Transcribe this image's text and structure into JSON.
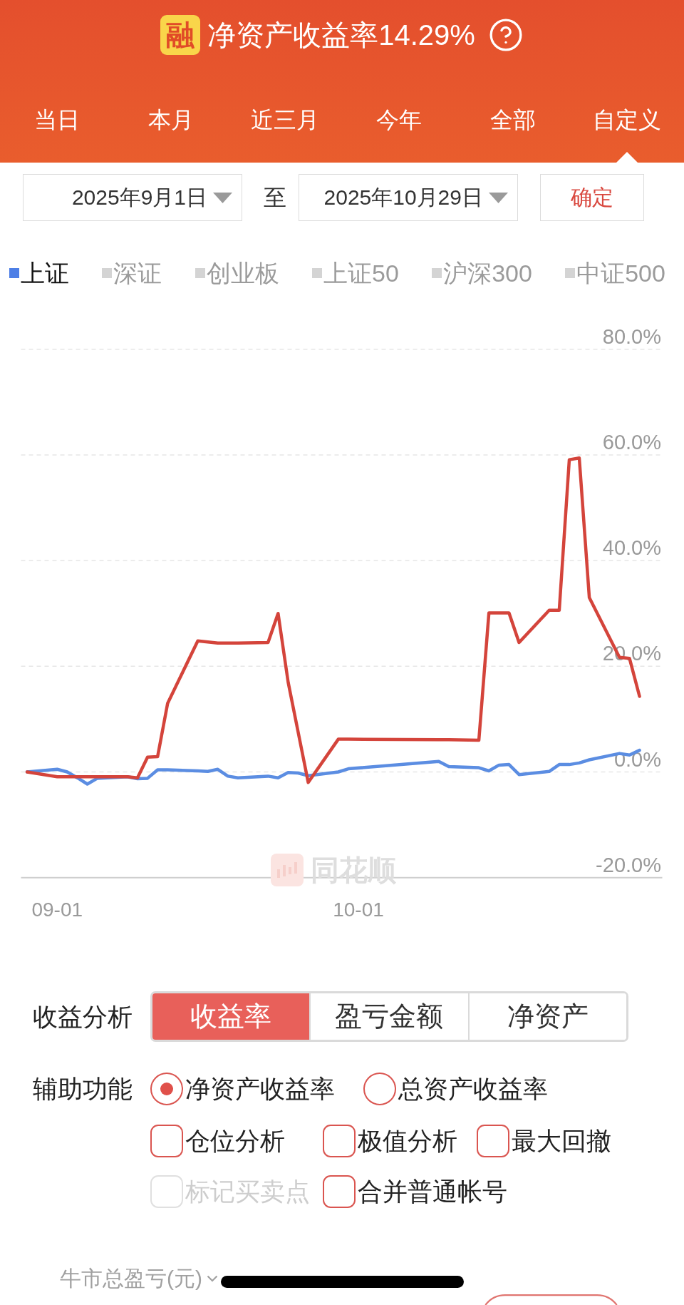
{
  "header": {
    "badge": "融",
    "title": "净资产收益率14.29%"
  },
  "tabs": [
    {
      "label": "当日",
      "selected": false
    },
    {
      "label": "本月",
      "selected": false
    },
    {
      "label": "近三月",
      "selected": false
    },
    {
      "label": "今年",
      "selected": false
    },
    {
      "label": "全部",
      "selected": false
    },
    {
      "label": "自定义",
      "selected": true
    }
  ],
  "date_range": {
    "start": "2025年9月1日",
    "separator": "至",
    "end": "2025年10月29日",
    "confirm": "确定"
  },
  "legend": [
    {
      "label": "上证",
      "selected": true
    },
    {
      "label": "深证",
      "selected": false
    },
    {
      "label": "创业板",
      "selected": false
    },
    {
      "label": "上证50",
      "selected": false
    },
    {
      "label": "沪深300",
      "selected": false
    },
    {
      "label": "中证500",
      "selected": false
    }
  ],
  "chart": {
    "watermark": "同花顺",
    "chart_data": {
      "type": "line",
      "grid": true,
      "categories": [
        null,
        null,
        null,
        "09-01",
        null,
        null,
        null,
        null,
        null,
        null,
        null,
        null,
        null,
        null,
        null,
        null,
        null,
        null,
        null,
        null,
        null,
        null,
        null,
        null,
        null,
        null,
        null,
        null,
        null,
        null,
        null,
        null,
        null,
        "10-01",
        null,
        null,
        null,
        null,
        null,
        null,
        null,
        null,
        null,
        null,
        null,
        null,
        null,
        null,
        null,
        null,
        null,
        null,
        null,
        null,
        null,
        null,
        null,
        null,
        null,
        null,
        null,
        null
      ],
      "ylim": [
        -20,
        80
      ],
      "yticks": [
        {
          "value": 80,
          "label": "80.0%"
        },
        {
          "value": 60,
          "label": "60.0%"
        },
        {
          "value": 40,
          "label": "40.0%"
        },
        {
          "value": 20,
          "label": "20.0%"
        },
        {
          "value": 0,
          "label": "0.0%"
        },
        {
          "value": -20,
          "label": "-20.0%"
        }
      ],
      "series": [
        {
          "color": "#d4443b",
          "values": [
            0,
            null,
            null,
            -0.9,
            -0.9,
            -0.9,
            -0.9,
            -0.9,
            null,
            null,
            -0.9,
            -1.1,
            2.8,
            2.9,
            13.0,
            null,
            null,
            24.8,
            24.6,
            24.4,
            24.4,
            24.4,
            null,
            null,
            24.5,
            30.0,
            17.0,
            7.5,
            -2.0,
            null,
            null,
            6.2,
            6.2,
            null,
            null,
            null,
            null,
            null,
            null,
            null,
            null,
            6.1,
            6.1,
            null,
            null,
            6.0,
            30.1,
            30.1,
            30.1,
            24.5,
            null,
            null,
            30.6,
            30.6,
            59.1,
            59.4,
            33.0,
            null,
            null,
            21.7,
            21.5,
            14.3
          ]
        },
        {
          "color": "#5b8de2",
          "values": [
            0,
            null,
            null,
            0.5,
            0,
            -1.1,
            -2.3,
            -1.2,
            null,
            null,
            -0.9,
            -1.3,
            -1.2,
            0.4,
            0.4,
            null,
            null,
            0.2,
            0.1,
            0.5,
            -0.8,
            -1.1,
            null,
            null,
            -0.8,
            -1.1,
            -0.1,
            -0.2,
            -0.7,
            null,
            null,
            0,
            0.6,
            null,
            null,
            null,
            null,
            null,
            null,
            null,
            null,
            2.0,
            1.0,
            null,
            null,
            0.8,
            0.2,
            1.3,
            1.4,
            -0.5,
            null,
            null,
            0.1,
            1.4,
            1.4,
            1.7,
            2.3,
            null,
            null,
            3.5,
            3.2,
            4.1
          ]
        }
      ]
    }
  },
  "analysis": {
    "label": "收益分析",
    "options": [
      {
        "label": "收益率",
        "selected": true
      },
      {
        "label": "盈亏金额",
        "selected": false
      },
      {
        "label": "净资产",
        "selected": false
      }
    ]
  },
  "auxiliary": {
    "label": "辅助功能",
    "radios": [
      {
        "label": "净资产收益率",
        "selected": true
      },
      {
        "label": "总资产收益率",
        "selected": false
      }
    ],
    "checkboxes": [
      {
        "label": "仓位分析",
        "checked": false,
        "disabled": false
      },
      {
        "label": "极值分析",
        "checked": false,
        "disabled": false
      },
      {
        "label": "最大回撤",
        "checked": false,
        "disabled": false
      },
      {
        "label": "标记买卖点",
        "checked": false,
        "disabled": true
      },
      {
        "label": "合并普通帐号",
        "checked": false,
        "disabled": false
      }
    ]
  },
  "footer": {
    "label": "牛市总盈亏(元)"
  }
}
